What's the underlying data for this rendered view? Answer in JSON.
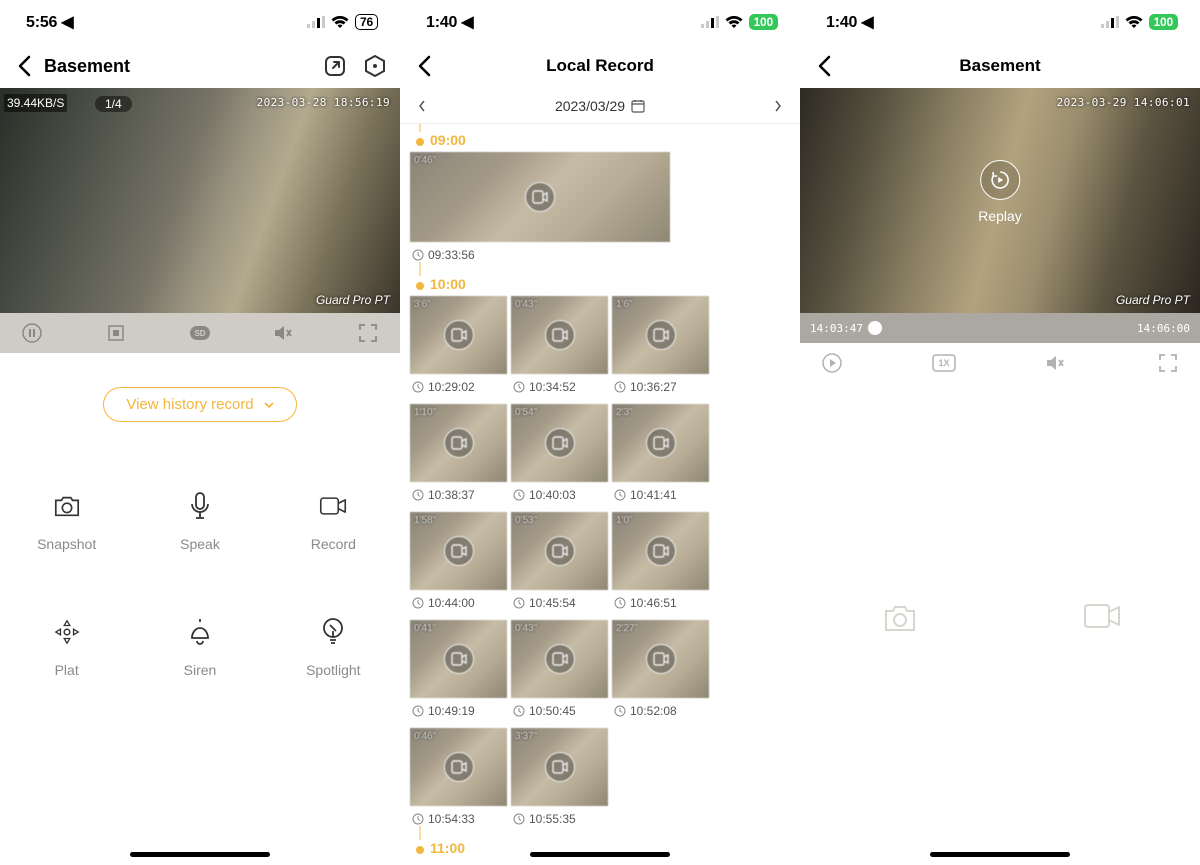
{
  "screen1": {
    "status": {
      "time": "5:56",
      "battery": "76"
    },
    "title": "Basement",
    "video": {
      "kbps": "39.44KB/S",
      "badge": "1/4",
      "timestamp": "2023-03-28 18:56:19",
      "model": "Guard Pro PT"
    },
    "view_history": "View history record",
    "actions": [
      {
        "name": "snapshot",
        "label": "Snapshot"
      },
      {
        "name": "speak",
        "label": "Speak"
      },
      {
        "name": "record",
        "label": "Record"
      },
      {
        "name": "plat",
        "label": "Plat"
      },
      {
        "name": "siren",
        "label": "Siren"
      },
      {
        "name": "spotlight",
        "label": "Spotlight"
      }
    ]
  },
  "screen2": {
    "status": {
      "time": "1:40",
      "battery": "100"
    },
    "title": "Local Record",
    "date": "2023/03/29",
    "hours": [
      {
        "hour": "09:00",
        "clips": [
          {
            "duration": "0'46\"",
            "time": "09:33:56",
            "big": true
          }
        ]
      },
      {
        "hour": "10:00",
        "clips": [
          {
            "duration": "3'6\"",
            "time": "10:29:02"
          },
          {
            "duration": "0'43\"",
            "time": "10:34:52"
          },
          {
            "duration": "1'6\"",
            "time": "10:36:27"
          },
          {
            "duration": "1'10\"",
            "time": "10:38:37"
          },
          {
            "duration": "0'54\"",
            "time": "10:40:03"
          },
          {
            "duration": "2'3\"",
            "time": "10:41:41"
          },
          {
            "duration": "1'58\"",
            "time": "10:44:00"
          },
          {
            "duration": "0'53\"",
            "time": "10:45:54"
          },
          {
            "duration": "1'0\"",
            "time": "10:46:51"
          },
          {
            "duration": "0'41\"",
            "time": "10:49:19"
          },
          {
            "duration": "0'43\"",
            "time": "10:50:45"
          },
          {
            "duration": "2'27\"",
            "time": "10:52:08"
          },
          {
            "duration": "0'46\"",
            "time": "10:54:33"
          },
          {
            "duration": "3'37\"",
            "time": "10:55:35"
          }
        ]
      },
      {
        "hour": "11:00",
        "clips": []
      }
    ]
  },
  "screen3": {
    "status": {
      "time": "1:40",
      "battery": "100"
    },
    "title": "Basement",
    "video": {
      "timestamp": "2023-03-29 14:06:01",
      "model": "Guard Pro PT",
      "replay": "Replay"
    },
    "scrubber": {
      "left": "14:03:47",
      "right": "14:06:00"
    }
  }
}
